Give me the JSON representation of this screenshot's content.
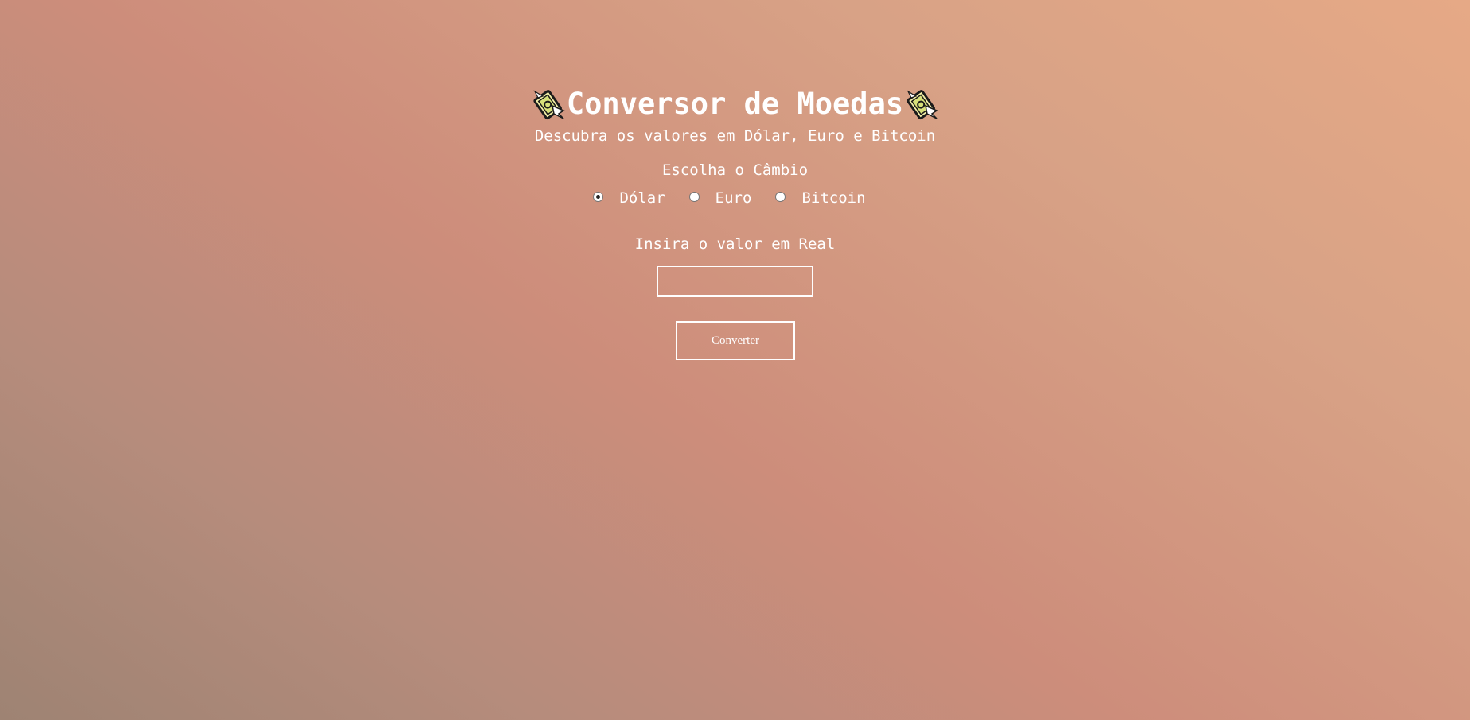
{
  "header": {
    "title": "Conversor de Moedas",
    "left_icon": "money-with-wings-icon",
    "right_icon": "money-with-wings-icon",
    "subtitle": "Descubra os valores em Dólar, Euro e Bitcoin"
  },
  "exchange": {
    "label": "Escolha o Câmbio",
    "options": [
      {
        "label": "Dólar",
        "checked": true
      },
      {
        "label": "Euro",
        "checked": false
      },
      {
        "label": "Bitcoin",
        "checked": false
      }
    ]
  },
  "amount": {
    "label": "Insira o valor em Real",
    "value": "",
    "placeholder": ""
  },
  "convert_button": {
    "label": "Converter"
  },
  "colors": {
    "text": "#ffffff",
    "gradient_start": "#9e8373",
    "gradient_mid": "#cd8d7b",
    "gradient_end": "#e6a986"
  }
}
